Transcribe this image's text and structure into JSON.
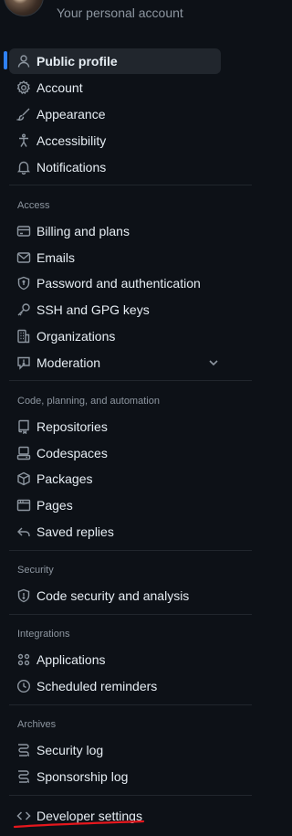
{
  "header": {
    "subtitle": "Your personal account"
  },
  "nav": {
    "items": [
      {
        "label": "Public profile",
        "icon": "person-icon"
      },
      {
        "label": "Account",
        "icon": "gear-icon"
      },
      {
        "label": "Appearance",
        "icon": "paintbrush-icon"
      },
      {
        "label": "Accessibility",
        "icon": "accessibility-icon"
      },
      {
        "label": "Notifications",
        "icon": "bell-icon"
      }
    ],
    "sections": [
      {
        "heading": "Access",
        "items": [
          {
            "label": "Billing and plans",
            "icon": "credit-card-icon"
          },
          {
            "label": "Emails",
            "icon": "mail-icon"
          },
          {
            "label": "Password and authentication",
            "icon": "shield-lock-icon"
          },
          {
            "label": "SSH and GPG keys",
            "icon": "key-icon"
          },
          {
            "label": "Organizations",
            "icon": "organization-icon"
          },
          {
            "label": "Moderation",
            "icon": "report-icon"
          }
        ]
      },
      {
        "heading": "Code, planning, and automation",
        "items": [
          {
            "label": "Repositories",
            "icon": "repo-icon"
          },
          {
            "label": "Codespaces",
            "icon": "codespaces-icon"
          },
          {
            "label": "Packages",
            "icon": "package-icon"
          },
          {
            "label": "Pages",
            "icon": "browser-icon"
          },
          {
            "label": "Saved replies",
            "icon": "reply-icon"
          }
        ]
      },
      {
        "heading": "Security",
        "items": [
          {
            "label": "Code security and analysis",
            "icon": "shield-check-icon"
          }
        ]
      },
      {
        "heading": "Integrations",
        "items": [
          {
            "label": "Applications",
            "icon": "apps-icon"
          },
          {
            "label": "Scheduled reminders",
            "icon": "clock-icon"
          }
        ]
      },
      {
        "heading": "Archives",
        "items": [
          {
            "label": "Security log",
            "icon": "log-icon"
          },
          {
            "label": "Sponsorship log",
            "icon": "log-icon"
          }
        ]
      }
    ],
    "footer_item": {
      "label": "Developer settings",
      "icon": "code-icon"
    }
  },
  "colors": {
    "background": "#0d1117",
    "active_bg": "#21262d",
    "accent": "#2f81f7",
    "text": "#e6edf3",
    "muted": "#8d96a0",
    "annotation": "#e5171d"
  }
}
